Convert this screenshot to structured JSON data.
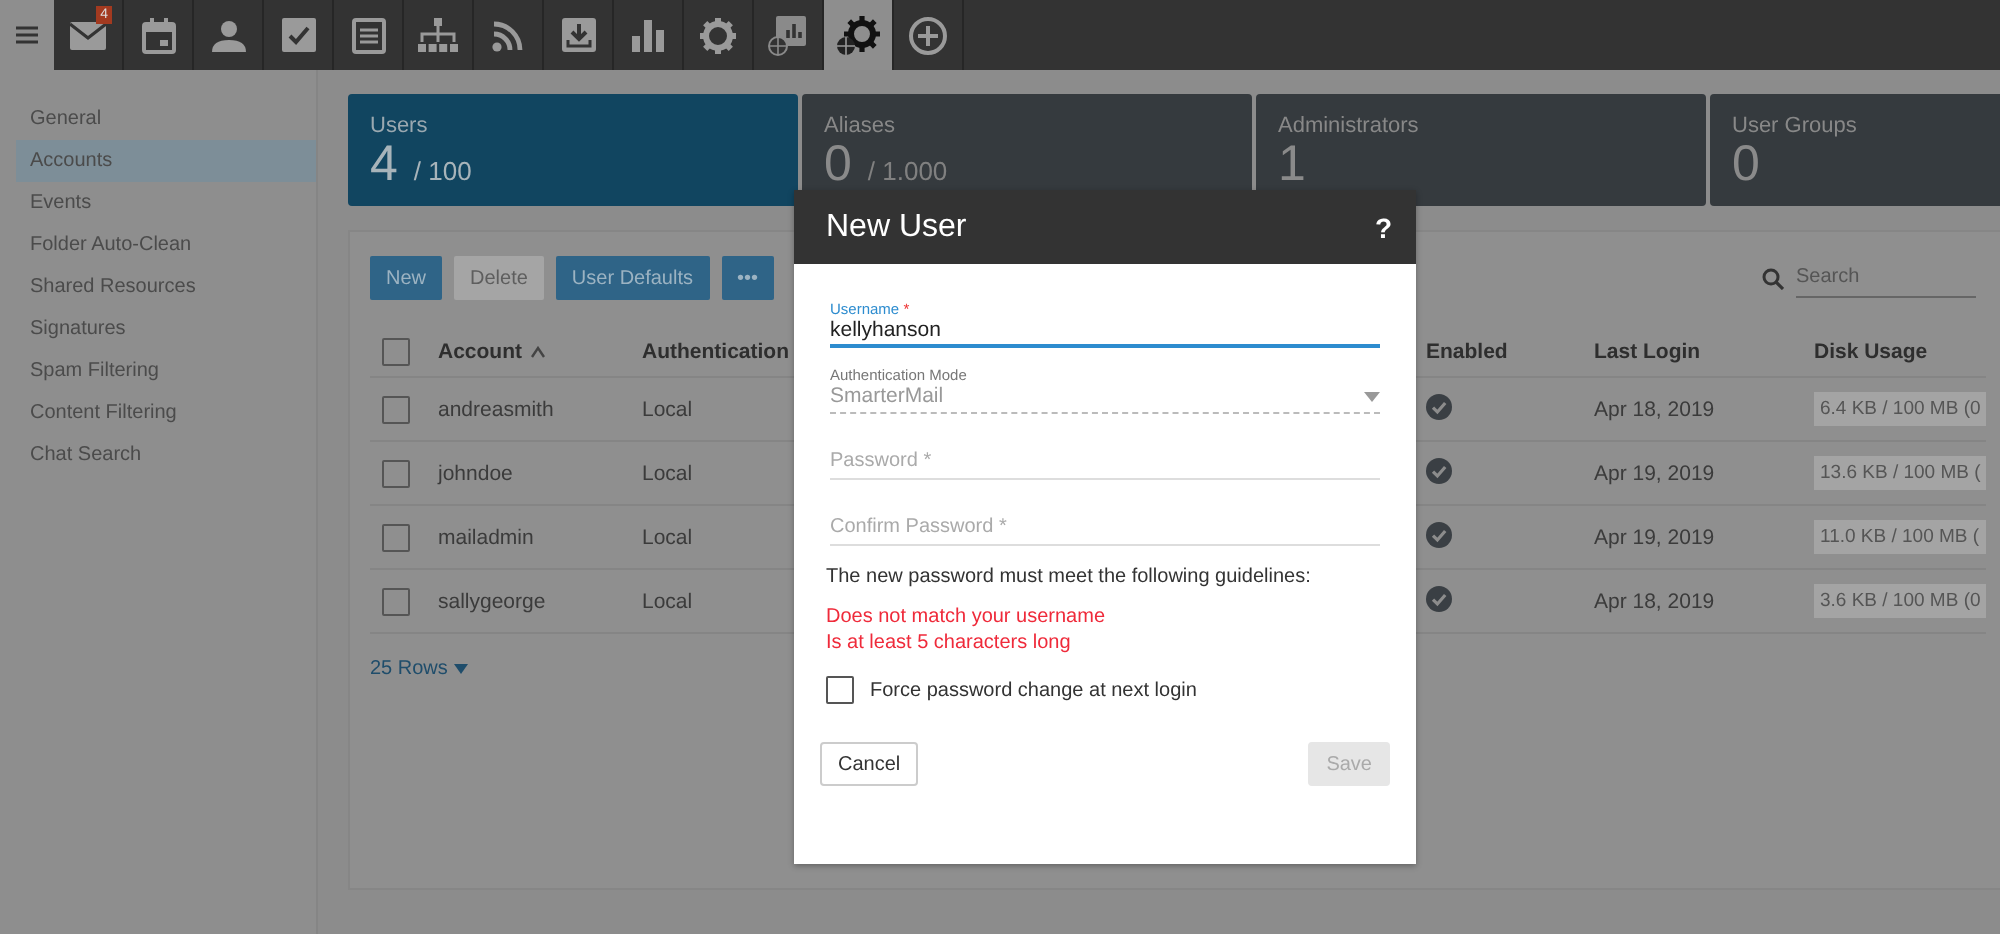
{
  "nav": {
    "items": [
      {
        "kind": "mail",
        "badge": "4",
        "selected": false
      },
      {
        "kind": "calendar",
        "selected": false
      },
      {
        "kind": "person",
        "selected": false
      },
      {
        "kind": "task",
        "selected": false
      },
      {
        "kind": "note",
        "selected": false
      },
      {
        "kind": "org",
        "selected": false
      },
      {
        "kind": "rss",
        "selected": false
      },
      {
        "kind": "download",
        "selected": false
      },
      {
        "kind": "chart",
        "selected": false
      },
      {
        "kind": "gear",
        "selected": false
      },
      {
        "kind": "report",
        "selected": false
      },
      {
        "kind": "gearglobe",
        "selected": true
      },
      {
        "kind": "plus",
        "selected": false
      }
    ]
  },
  "sidebar": {
    "items": [
      {
        "label": "General",
        "selected": false
      },
      {
        "label": "Accounts",
        "selected": true
      },
      {
        "label": "Events",
        "selected": false
      },
      {
        "label": "Folder Auto-Clean",
        "selected": false
      },
      {
        "label": "Shared Resources",
        "selected": false
      },
      {
        "label": "Signatures",
        "selected": false
      },
      {
        "label": "Spam Filtering",
        "selected": false
      },
      {
        "label": "Content Filtering",
        "selected": false
      },
      {
        "label": "Chat Search",
        "selected": false
      }
    ]
  },
  "cards": [
    {
      "label": "Users",
      "count": "4",
      "limit": "/ 100",
      "selected": true
    },
    {
      "label": "Aliases",
      "count": "0",
      "limit": "/ 1.000",
      "selected": false
    },
    {
      "label": "Administrators",
      "count": "1",
      "selected": false
    },
    {
      "label": "User Groups",
      "count": "0",
      "selected": false
    }
  ],
  "toolbar": {
    "buttons": [
      {
        "label": "New",
        "disabled": false
      },
      {
        "label": "Delete",
        "disabled": true
      },
      {
        "label": "User Defaults",
        "disabled": false
      },
      {
        "label": "•••",
        "disabled": false
      }
    ],
    "search": {
      "placeholder": "Search"
    }
  },
  "table": {
    "all_selected": false,
    "columns": [
      {
        "label": "Account",
        "sorted": true
      },
      {
        "label": "Authentication",
        "sorted": false
      },
      {
        "label": "Enabled",
        "sorted": false
      },
      {
        "label": "Last Login",
        "sorted": false
      },
      {
        "label": "Disk Usage",
        "sorted": false
      }
    ],
    "rows": [
      {
        "selected": false,
        "account": "andreasmith",
        "authentication": "Local",
        "enabled": true,
        "last_login": "Apr 18, 2019",
        "disk_usage": "6.4 KB / 100 MB (0"
      },
      {
        "selected": false,
        "account": "johndoe",
        "authentication": "Local",
        "enabled": true,
        "last_login": "Apr 19, 2019",
        "disk_usage": "13.6 KB / 100 MB ("
      },
      {
        "selected": false,
        "account": "mailadmin",
        "authentication": "Local",
        "enabled": true,
        "last_login": "Apr 19, 2019",
        "disk_usage": "11.0 KB / 100 MB ("
      },
      {
        "selected": false,
        "account": "sallygeorge",
        "authentication": "Local",
        "enabled": true,
        "last_login": "Apr 18, 2019",
        "disk_usage": "3.6 KB / 100 MB (0"
      }
    ],
    "footer": "25 Rows"
  },
  "dialog": {
    "title": "New User",
    "help": "?",
    "fields": [
      {
        "kind": "text",
        "label": "Username",
        "required_mark": "*",
        "value": "kellyhanson",
        "focused": true
      },
      {
        "kind": "select",
        "label": "Authentication Mode",
        "value": "SmarterMail",
        "disabled": true
      },
      {
        "kind": "password",
        "placeholder": "Password",
        "required_mark": "*"
      },
      {
        "kind": "password",
        "placeholder": "Confirm Password",
        "required_mark": "*"
      }
    ],
    "guidelines": "The new password must meet the following guidelines:",
    "rules": [
      {
        "text": "Does not match your username",
        "met": false
      },
      {
        "text": "Is at least 5 characters long",
        "met": false
      }
    ],
    "force_change": {
      "label": "Force password change at next login",
      "checked": false
    },
    "buttons": [
      {
        "label": "Cancel",
        "disabled": false
      },
      {
        "label": "Save",
        "disabled": true
      }
    ]
  }
}
